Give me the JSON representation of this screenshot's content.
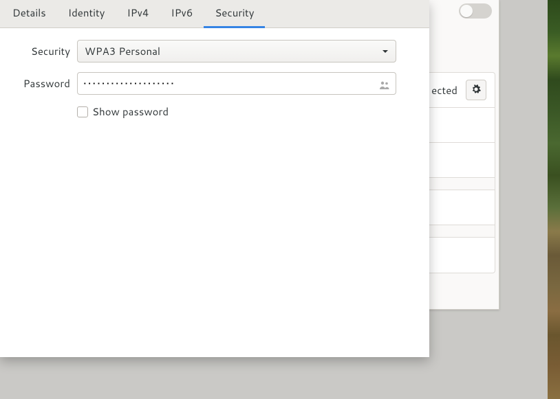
{
  "tabs": [
    {
      "label": "Details",
      "active": false
    },
    {
      "label": "Identity",
      "active": false
    },
    {
      "label": "IPv4",
      "active": false
    },
    {
      "label": "IPv6",
      "active": false
    },
    {
      "label": "Security",
      "active": true
    }
  ],
  "form": {
    "security_label": "Security",
    "security_value": "WPA3 Personal",
    "password_label": "Password",
    "password_value": "••••••••••••••••••••",
    "show_password_label": "Show password"
  },
  "parent": {
    "connected_label": "ected"
  }
}
